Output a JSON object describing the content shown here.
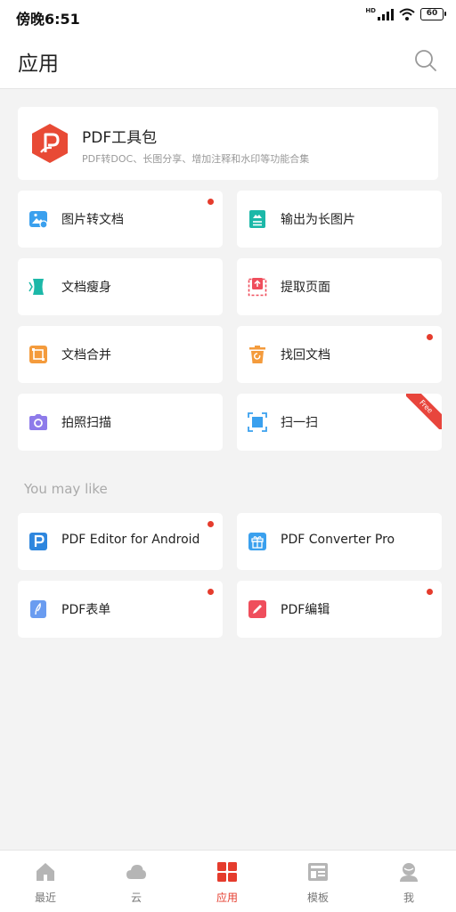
{
  "status_bar": {
    "time": "傍晚6:51",
    "hd": "HD",
    "battery": "60"
  },
  "header": {
    "title": "应用",
    "search_icon": "search-icon"
  },
  "pdf_toolkit": {
    "title": "PDF工具包",
    "subtitle": "PDF转DOC、长图分享、增加注释和水印等功能合集",
    "icon": "pdf-logo-icon",
    "color": "#e84a35"
  },
  "tools": [
    {
      "label": "图片转文档",
      "icon": "image-to-doc-icon",
      "dot": true
    },
    {
      "label": "输出为长图片",
      "icon": "long-image-icon",
      "dot": false
    },
    {
      "label": "文档瘦身",
      "icon": "slim-doc-icon",
      "dot": false
    },
    {
      "label": "提取页面",
      "icon": "extract-page-icon",
      "dot": false
    },
    {
      "label": "文档合并",
      "icon": "merge-doc-icon",
      "dot": false
    },
    {
      "label": "找回文档",
      "icon": "recover-doc-icon",
      "dot": true
    },
    {
      "label": "拍照扫描",
      "icon": "camera-scan-icon",
      "dot": false
    },
    {
      "label": "扫一扫",
      "icon": "qr-scan-icon",
      "badge": "Free"
    }
  ],
  "you_may_like": {
    "heading": "You may like",
    "items": [
      {
        "label": "PDF Editor for Android",
        "icon": "pdf-editor-icon",
        "dot": true
      },
      {
        "label": "PDF Converter Pro",
        "icon": "gift-icon",
        "dot": false
      },
      {
        "label": "PDF表单",
        "icon": "pdf-form-icon",
        "dot": true
      },
      {
        "label": "PDF编辑",
        "icon": "pdf-edit-icon",
        "dot": true
      }
    ]
  },
  "tab_bar": {
    "tabs": [
      {
        "label": "最近",
        "icon": "home-icon",
        "active": false
      },
      {
        "label": "云",
        "icon": "cloud-icon",
        "active": false
      },
      {
        "label": "应用",
        "icon": "apps-grid-icon",
        "active": true
      },
      {
        "label": "模板",
        "icon": "template-icon",
        "active": false
      },
      {
        "label": "我",
        "icon": "profile-icon",
        "active": false
      }
    ],
    "active_color": "#e53c2d",
    "inactive_color": "#b5b5b5"
  }
}
